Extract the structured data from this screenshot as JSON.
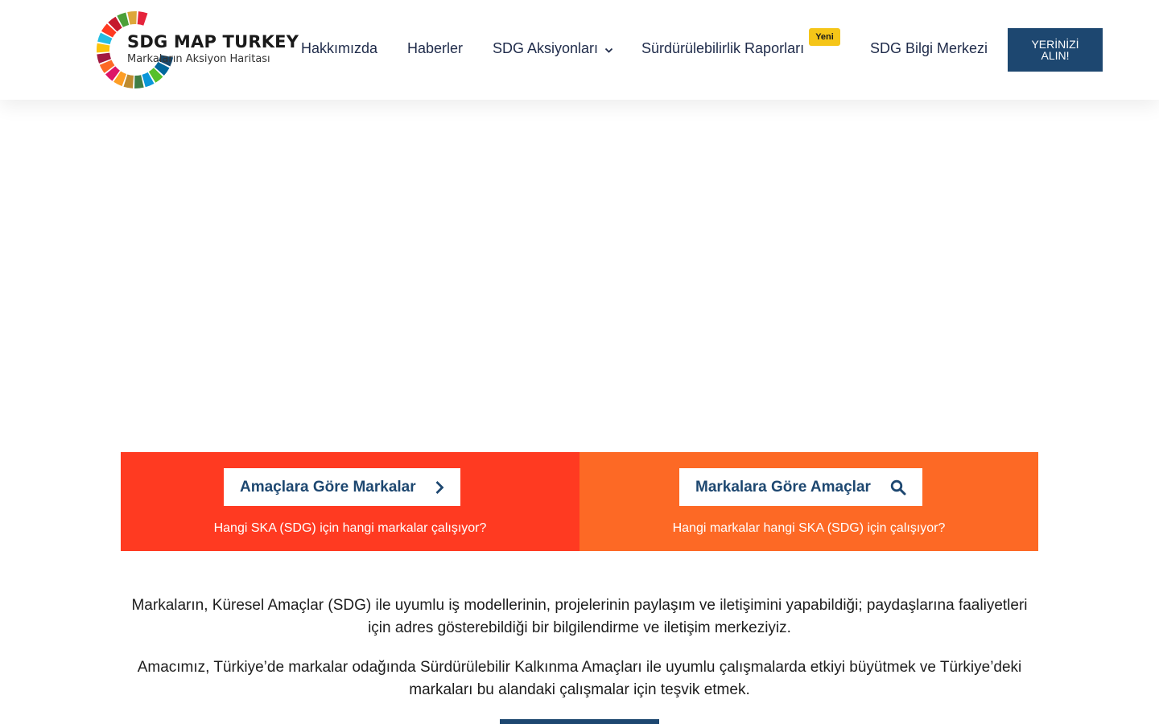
{
  "logo": {
    "title": "SDG MAP TURKEY",
    "subtitle": "Markaların Aksiyon Haritası",
    "wheel_colors": [
      "#e5243b",
      "#dda63a",
      "#4c9f38",
      "#c5192d",
      "#ff3a21",
      "#26bde2",
      "#fcc30b",
      "#a21942",
      "#fd6925",
      "#dd1367",
      "#fd9d24",
      "#bf8b2e",
      "#3f7e44",
      "#0a97d9",
      "#56c02b",
      "#00689d",
      "#19486a"
    ]
  },
  "nav": {
    "items": [
      {
        "label": "Hakkımızda"
      },
      {
        "label": "Haberler"
      },
      {
        "label": "SDG Aksiyonları"
      },
      {
        "label": "Sürdürülebilirlik Raporları"
      },
      {
        "label": "SDG Bilgi Merkezi"
      }
    ],
    "badge": "Yeni",
    "cta_line1": "YERİNİZİ",
    "cta_line2": "ALIN!"
  },
  "bands": {
    "left": {
      "button": "Amaçlara Göre Markalar",
      "caption": "Hangi SKA (SDG) için hangi markalar çalışıyor?",
      "icon": "chevron-right-icon"
    },
    "right": {
      "button": "Markalara Göre Amaçlar",
      "caption": "Hangi markalar hangi SKA (SDG) için çalışıyor?",
      "icon": "search-icon"
    }
  },
  "intro": {
    "p1": "Markaların, Küresel Amaçlar (SDG) ile uyumlu iş modellerinin, projelerinin paylaşım ve iletişimini yapabildiği; paydaşlarına faaliyetleri için adres gösterebildiği bir bilgilendirme ve iletişim merkeziyiz.",
    "p2": "Amacımız, Türkiye’de markalar odağında Sürdürülebilir Kalkınma Amaçları ile uyumlu çalışmalarda etkiyi büyütmek ve Türkiye’deki markaları bu alandaki çalışmalar için teşvik etmek."
  },
  "colors": {
    "brand_navy": "#1d4770",
    "band_left": "#ff3a21",
    "band_right": "#fd6925",
    "badge": "#f5c518"
  }
}
